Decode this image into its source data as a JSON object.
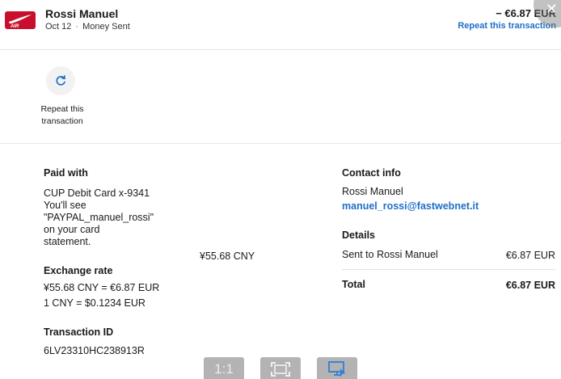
{
  "header": {
    "merchant_name": "Rossi Manuel",
    "date": "Oct 12",
    "separator": "·",
    "type": "Money Sent",
    "amount": "− €6.87 EUR",
    "repeat_link": "Repeat this transaction",
    "logo_icon": "nike-air-logo",
    "close_icon": "close-icon"
  },
  "actions": {
    "repeat_label": "Repeat this transaction",
    "repeat_icon": "refresh-icon"
  },
  "paid_with": {
    "title": "Paid with",
    "card": "CUP Debit Card x-9341",
    "lines": [
      "You'll see",
      "\"PAYPAL_manuel_rossi\"",
      "on your card",
      "statement."
    ],
    "amount_cny": "¥55.68 CNY"
  },
  "exchange_rate": {
    "title": "Exchange rate",
    "line1": "¥55.68 CNY = €6.87 EUR",
    "line2": "1 CNY = $0.1234 EUR"
  },
  "transaction": {
    "title": "Transaction ID",
    "id": "6LV23310HC238913R"
  },
  "contact": {
    "title": "Contact info",
    "name": "Rossi Manuel",
    "email": "manuel_rossi@fastwebnet.it"
  },
  "details": {
    "title": "Details",
    "sent_label": "Sent to Rossi Manuel",
    "sent_amount": "€6.87 EUR",
    "total_label": "Total",
    "total_amount": "€6.87 EUR"
  },
  "viewer_controls": {
    "actual_size_label": "1:1",
    "fit_icon": "fit-screen-icon",
    "display_icon": "display-settings-icon"
  },
  "colors": {
    "link_blue": "#1e6fc9",
    "logo_red": "#c8102e",
    "divider": "#e6e6e6",
    "control_gray": "#b3b3b3"
  }
}
